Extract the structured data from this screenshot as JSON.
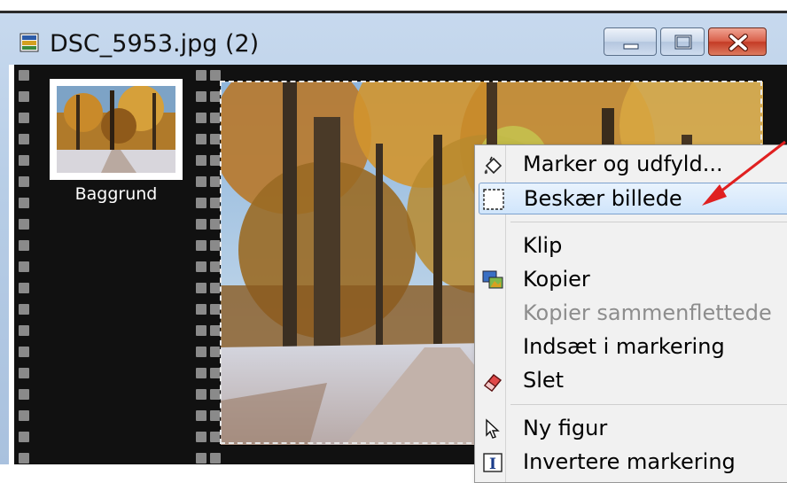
{
  "window": {
    "title": "DSC_5953.jpg (2)",
    "buttons": {
      "minimize": "minimize-icon",
      "maximize": "maximize-icon",
      "close": "close-icon"
    }
  },
  "layers": {
    "items": [
      {
        "name": "Baggrund"
      }
    ]
  },
  "context_menu": {
    "items": [
      {
        "label": "Marker og udfyld...",
        "icon": "select-fill-icon"
      },
      {
        "label": "Beskær billede",
        "icon": "crop-icon",
        "highlighted": true
      },
      {
        "label": "Klip"
      },
      {
        "label": "Kopier",
        "icon": "copy-icon"
      },
      {
        "label": "Kopier sammenflettede",
        "disabled": true
      },
      {
        "label": "Indsæt i markering"
      },
      {
        "label": "Slet",
        "icon": "eraser-icon"
      },
      {
        "label": "Ny figur",
        "icon": "cursor-icon"
      },
      {
        "label": "Invertere markering",
        "icon": "invert-icon"
      }
    ]
  },
  "colors": {
    "window_frame": "#b7cde6",
    "film_strip": "#111111",
    "menu_highlight": "#d0e5fb",
    "annotation_arrow": "#e02020"
  }
}
